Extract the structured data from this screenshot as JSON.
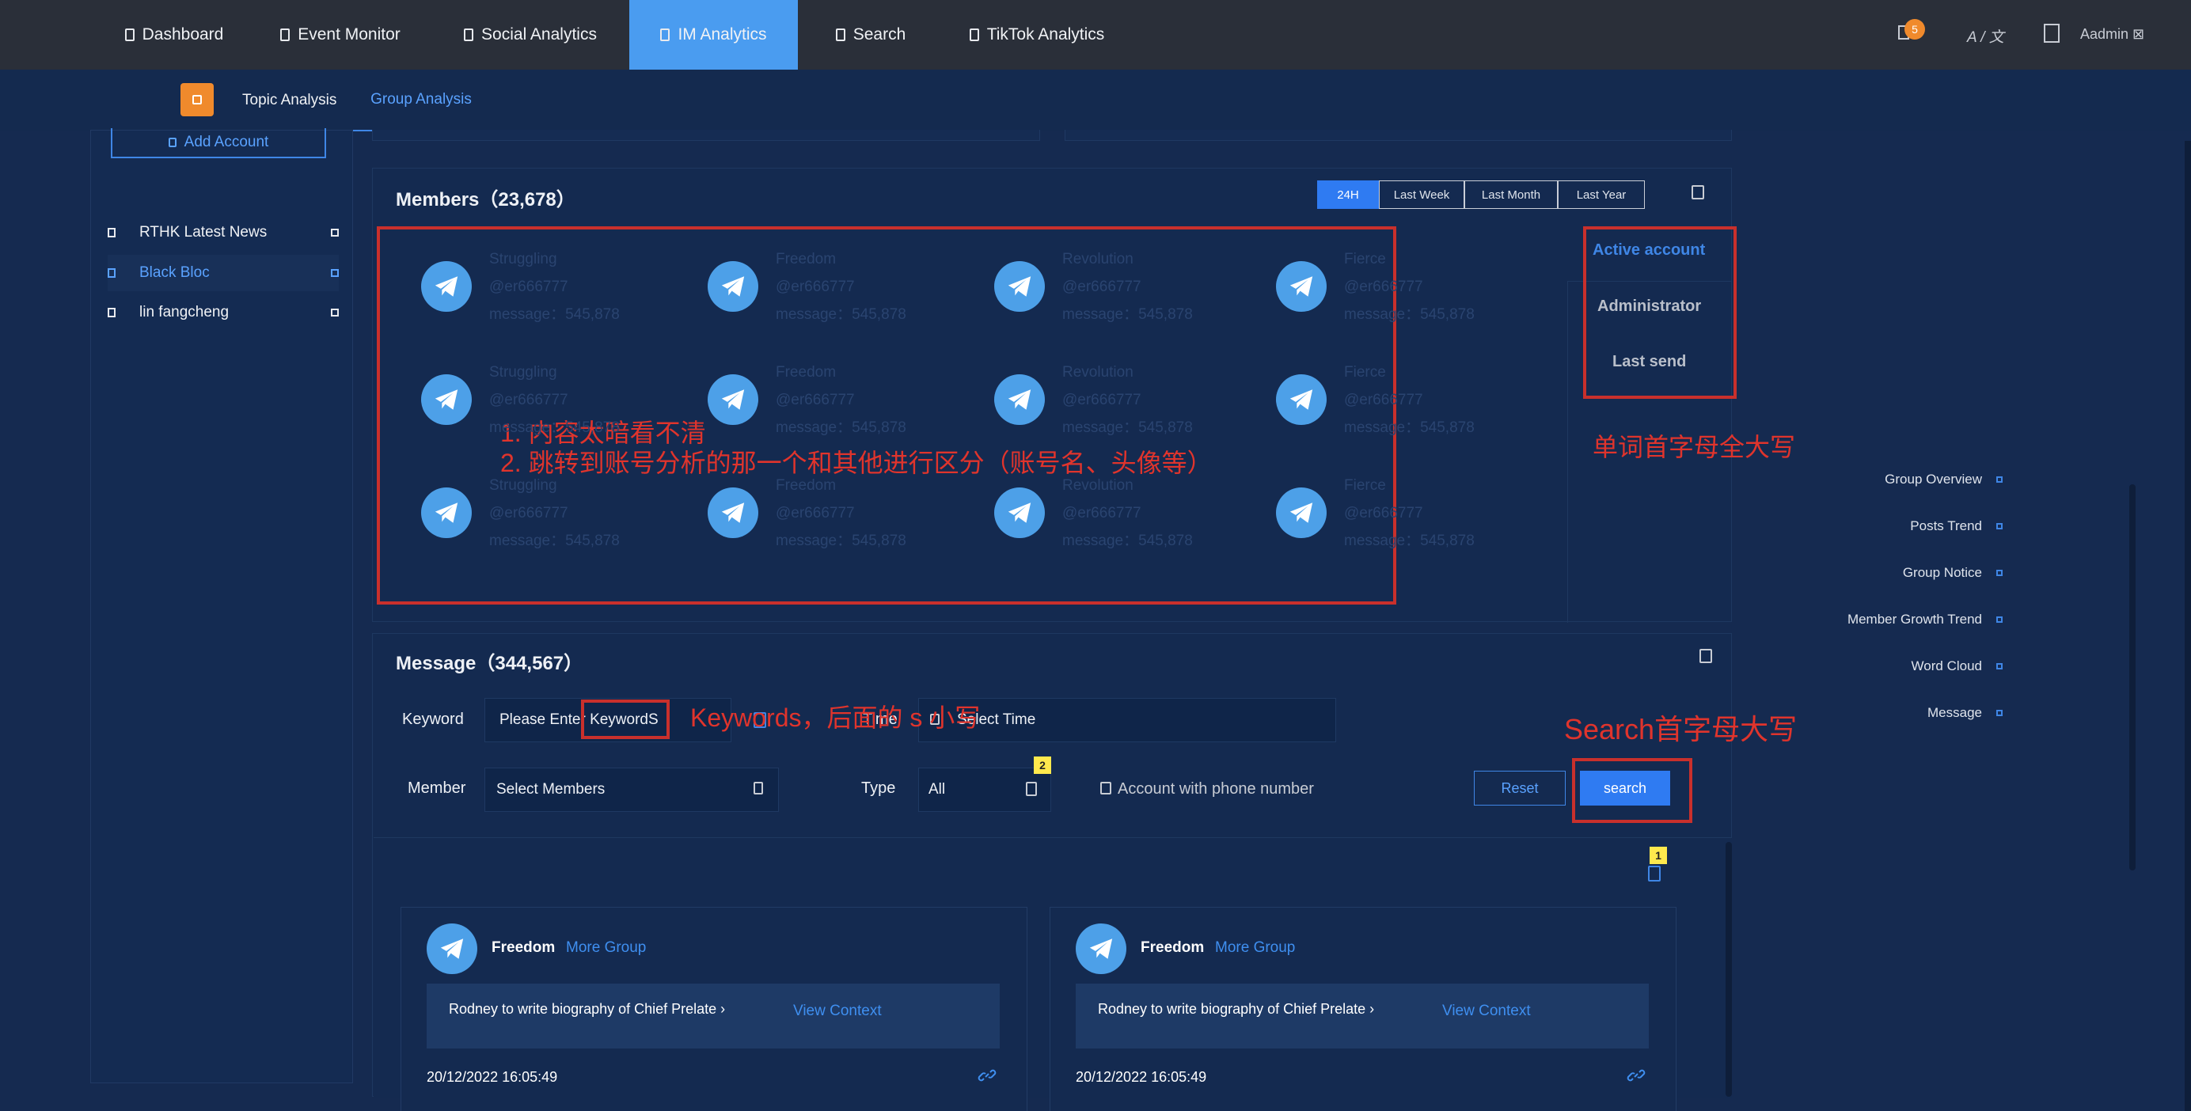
{
  "nav": {
    "items": [
      {
        "label": "Dashboard"
      },
      {
        "label": "Event Monitor"
      },
      {
        "label": "Social Analytics"
      },
      {
        "label": "IM Analytics"
      },
      {
        "label": "Search"
      },
      {
        "label": "TikTok Analytics"
      }
    ],
    "notification_count": "5",
    "language_label": "A / 文",
    "user_label": "Aadmin ⊠"
  },
  "subnav": {
    "tabs": [
      {
        "label": "Topic Analysis"
      },
      {
        "label": "Group Analysis"
      }
    ]
  },
  "sidebar": {
    "add_account": "Add Account",
    "items": [
      {
        "label": "RTHK Latest News"
      },
      {
        "label": "Black Bloc"
      },
      {
        "label": "lin fangcheng"
      }
    ]
  },
  "members": {
    "title": "Members（23,678）",
    "ranges": [
      {
        "label": "24H"
      },
      {
        "label": "Last Week"
      },
      {
        "label": "Last Month"
      },
      {
        "label": "Last Year"
      }
    ],
    "grid": [
      {
        "name": "Struggling",
        "handle": "@er666777",
        "message": "message：545,878"
      },
      {
        "name": "Freedom",
        "handle": "@er666777",
        "message": "message：545,878"
      },
      {
        "name": "Revolution",
        "handle": "@er666777",
        "message": "message：545,878"
      },
      {
        "name": "Fierce",
        "handle": "@er666777",
        "message": "message：545,878"
      },
      {
        "name": "Struggling",
        "handle": "@er666777",
        "message": "message：545,878"
      },
      {
        "name": "Freedom",
        "handle": "@er666777",
        "message": "message：545,878"
      },
      {
        "name": "Revolution",
        "handle": "@er666777",
        "message": "message：545,878"
      },
      {
        "name": "Fierce",
        "handle": "@er666777",
        "message": "message：545,878"
      },
      {
        "name": "Struggling",
        "handle": "@er666777",
        "message": "message：545,878"
      },
      {
        "name": "Freedom",
        "handle": "@er666777",
        "message": "message：545,878"
      },
      {
        "name": "Revolution",
        "handle": "@er666777",
        "message": "message：545,878"
      },
      {
        "name": "Fierce",
        "handle": "@er666777",
        "message": "message：545,878"
      }
    ],
    "sort_options": [
      {
        "label": "Active account"
      },
      {
        "label": "Administrator"
      },
      {
        "label": "Last send"
      }
    ]
  },
  "annotations": {
    "dark_content": "1. 内容太暗看不清",
    "distinguish": "2. 跳转到账号分析的那一个和其他进行区分（账号名、头像等）",
    "capitalize": "单词首字母全大写",
    "keywords_note": "Keywords，后面的 s 小写",
    "search_note": "Search首字母大写",
    "badge_1": "1",
    "badge_2": "2"
  },
  "message": {
    "title": "Message（344,567）",
    "keyword_label": "Keyword",
    "keyword_placeholder": "Please Enter KeywordS",
    "time_label": "Time",
    "time_placeholder": "Select Time",
    "member_label": "Member",
    "member_placeholder": "Select Members",
    "type_label": "Type",
    "type_value": "All",
    "phone_checkbox": "Account with phone number",
    "reset": "Reset",
    "search": "search",
    "cards": [
      {
        "name": "Freedom",
        "group": "More Group",
        "text": "Rodney to write biography of Chief Prelate ›",
        "context": "View Context",
        "time": "20/12/2022 16:05:49"
      },
      {
        "name": "Freedom",
        "group": "More Group",
        "text": "Rodney to write biography of Chief Prelate ›",
        "context": "View Context",
        "time": "20/12/2022 16:05:49"
      }
    ]
  },
  "right_nav": [
    {
      "label": "Group Overview"
    },
    {
      "label": "Posts Trend"
    },
    {
      "label": "Group Notice"
    },
    {
      "label": "Member Growth Trend"
    },
    {
      "label": "Word Cloud"
    },
    {
      "label": "Message"
    }
  ],
  "colors": {
    "accent": "#2f7bf2",
    "annotation": "#c9302c",
    "background": "#152a50"
  }
}
